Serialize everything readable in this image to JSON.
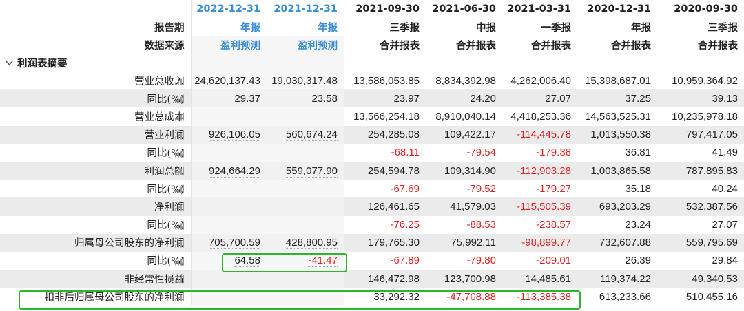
{
  "header": {
    "report_period_label": "报告期",
    "data_source_label": "数据来源",
    "columns": [
      {
        "date": "2022-12-31",
        "type": "年报",
        "source": "盈利预测",
        "forecast": true
      },
      {
        "date": "2021-12-31",
        "type": "年报",
        "source": "盈利预测",
        "forecast": true
      },
      {
        "date": "2021-09-30",
        "type": "三季报",
        "source": "合并报表",
        "forecast": false
      },
      {
        "date": "2021-06-30",
        "type": "中报",
        "source": "合并报表",
        "forecast": false
      },
      {
        "date": "2021-03-31",
        "type": "一季报",
        "source": "合并报表",
        "forecast": false
      },
      {
        "date": "2020-12-31",
        "type": "年报",
        "source": "合并报表",
        "forecast": false
      },
      {
        "date": "2020-09-30",
        "type": "三季报",
        "source": "合并报表",
        "forecast": false
      }
    ]
  },
  "section": {
    "label": "利润表摘要",
    "collapse_icon": "chevron-down-icon"
  },
  "rows": [
    {
      "label": "营业总收入",
      "indent": 1,
      "values": [
        "24,620,137.43",
        "19,030,317.48",
        "13,586,053.85",
        "8,834,392.98",
        "4,262,006.40",
        "15,398,687.01",
        "10,959,364.92"
      ]
    },
    {
      "label": "同比(%)",
      "indent": 2,
      "values": [
        "29.37",
        "23.58",
        "23.97",
        "24.20",
        "27.07",
        "37.25",
        "39.13"
      ]
    },
    {
      "label": "营业总成本",
      "indent": 1,
      "values": [
        "",
        "",
        "13,566,254.18",
        "8,910,040.14",
        "4,418,253.36",
        "14,563,525.31",
        "10,235,978.18"
      ]
    },
    {
      "label": "营业利润",
      "indent": 1,
      "values": [
        "926,106.05",
        "560,674.24",
        "254,285.08",
        "109,422.17",
        "-114,445.78",
        "1,013,550.38",
        "797,417.05"
      ]
    },
    {
      "label": "同比(%)",
      "indent": 2,
      "values": [
        "",
        "",
        "-68.11",
        "-79.54",
        "-179.38",
        "36.81",
        "41.49"
      ]
    },
    {
      "label": "利润总额",
      "indent": 1,
      "values": [
        "924,664.29",
        "559,077.90",
        "254,594.78",
        "109,314.90",
        "-112,903.28",
        "1,003,865.58",
        "787,895.83"
      ]
    },
    {
      "label": "同比(%)",
      "indent": 2,
      "values": [
        "",
        "",
        "-67.69",
        "-79.52",
        "-179.27",
        "35.18",
        "40.24"
      ]
    },
    {
      "label": "净利润",
      "indent": 1,
      "values": [
        "",
        "",
        "126,461.65",
        "41,579.03",
        "-115,505.39",
        "693,203.29",
        "532,387.56"
      ]
    },
    {
      "label": "同比(%)",
      "indent": 2,
      "values": [
        "",
        "",
        "-76.25",
        "-88.53",
        "-238.57",
        "23.24",
        "27.07"
      ]
    },
    {
      "label": "归属母公司股东的净利润",
      "indent": 1,
      "values": [
        "705,700.59",
        "428,800.95",
        "179,765.30",
        "75,992.11",
        "-98,899.77",
        "732,607.88",
        "559,795.69"
      ]
    },
    {
      "label": "同比(%)",
      "indent": 2,
      "values": [
        "64.58",
        "-41.47",
        "-67.89",
        "-79.80",
        "-209.01",
        "26.39",
        "29.84"
      ]
    },
    {
      "label": "非经常性损益",
      "indent": 1,
      "values": [
        "",
        "",
        "146,472.98",
        "123,700.98",
        "14,485.61",
        "119,374.22",
        "49,340.53"
      ]
    },
    {
      "label": "扣非后归属母公司股东的净利润",
      "indent": 0,
      "values": [
        "",
        "",
        "33,292.32",
        "-47,708.88",
        "-113,385.38",
        "613,233.66",
        "510,455.16"
      ]
    }
  ],
  "row_icon": "bar-chart-icon",
  "colors": {
    "forecast_header": "#3a8fd6",
    "negative": "#e02020",
    "highlight_box": "#2db52d",
    "alt_row": "#ebebeb"
  }
}
